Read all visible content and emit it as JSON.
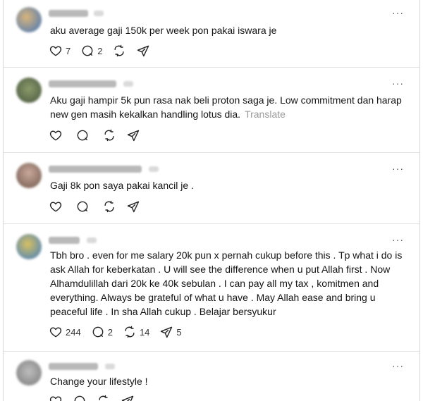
{
  "comments": [
    {
      "text": "aku average gaji 150k per week pon pakai iswara je",
      "likes": "7",
      "replies": "2",
      "reposts": "",
      "shares": "",
      "translate": ""
    },
    {
      "text": "Aku gaji hampir 5k pun rasa nak beli proton saga je. Low commitment dan harap new gen masih kekalkan handling lotus dia.",
      "likes": "",
      "replies": "",
      "reposts": "",
      "shares": "",
      "translate": "Translate"
    },
    {
      "text": "Gaji 8k pon saya pakai kancil je .",
      "likes": "",
      "replies": "",
      "reposts": "",
      "shares": "",
      "translate": ""
    },
    {
      "text": "Tbh bro . even for me salary 20k pun x pernah cukup before this . Tp what i do is ask Allah for keberkatan . U will see the difference when u put Allah first . Now Alhamdulillah dari 20k ke 40k sebulan . I can pay all my tax , komitmen and everything. Always be grateful of what u have . May Allah ease and bring u peaceful life . In sha Allah cukup . Belajar bersyukur",
      "likes": "244",
      "replies": "2",
      "reposts": "14",
      "shares": "5",
      "translate": ""
    },
    {
      "text": "Change your lifestyle !",
      "likes": "",
      "replies": "",
      "reposts": "",
      "shares": "",
      "translate": ""
    }
  ],
  "more_label": "···",
  "colors": {
    "text": "#141414",
    "muted": "#9a9a9a",
    "divider": "#e2e2e2"
  },
  "icons": [
    "heart-icon",
    "comment-icon",
    "repost-icon",
    "share-icon",
    "more-icon"
  ]
}
